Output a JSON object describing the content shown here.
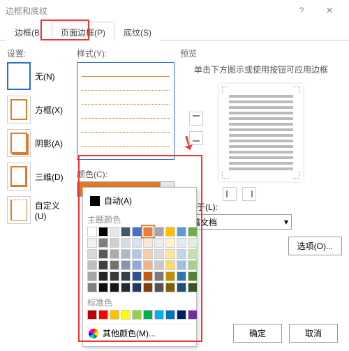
{
  "title": "边框和底纹",
  "tabs": {
    "border": "边框(B)",
    "page_border": "页面边框(P)",
    "shading": "底纹(S)"
  },
  "settings": {
    "label": "设置:",
    "none": "无(N)",
    "box": "方框(X)",
    "shadow": "阴影(A)",
    "threed": "三维(D)",
    "custom": "自定义(U)"
  },
  "style_label": "样式(Y):",
  "color": {
    "label": "颜色(C):",
    "auto": "自动(A)",
    "theme": "主题颜色",
    "standard": "标准色",
    "more": "其他颜色(M)...",
    "theme_row1": [
      "#ffffff",
      "#000000",
      "#e7e6e6",
      "#44546a",
      "#4472c4",
      "#ed7d31",
      "#a5a5a5",
      "#ffc000",
      "#5b9bd5",
      "#70ad47"
    ],
    "theme_row2": [
      "#f2f2f2",
      "#7f7f7f",
      "#d0cece",
      "#d6dce4",
      "#d9e2f3",
      "#fbe5d5",
      "#ededed",
      "#fff2cc",
      "#deebf6",
      "#e2efd9"
    ],
    "theme_row3": [
      "#d8d8d8",
      "#595959",
      "#aeabab",
      "#adb9ca",
      "#b4c6e7",
      "#f7cbac",
      "#dbdbdb",
      "#fee599",
      "#bdd7ee",
      "#c5e0b3"
    ],
    "theme_row4": [
      "#bfbfbf",
      "#3f3f3f",
      "#757070",
      "#8496b0",
      "#8eaadb",
      "#f4b183",
      "#c9c9c9",
      "#ffd965",
      "#9cc3e5",
      "#a8d08d"
    ],
    "theme_row5": [
      "#a5a5a5",
      "#262626",
      "#3a3838",
      "#323f4f",
      "#2f5496",
      "#c55a11",
      "#7b7b7b",
      "#bf9000",
      "#2e75b5",
      "#538135"
    ],
    "theme_row6": [
      "#7f7f7f",
      "#0c0c0c",
      "#171616",
      "#222a35",
      "#1f3864",
      "#833c0b",
      "#525252",
      "#7f6000",
      "#1e4e79",
      "#375623"
    ],
    "standard_row": [
      "#c00000",
      "#ff0000",
      "#ffc000",
      "#ffff00",
      "#92d050",
      "#00b050",
      "#00b0f0",
      "#0070c0",
      "#002060",
      "#7030a0"
    ],
    "selected_hex": "#ed7d31"
  },
  "preview": {
    "label": "预览",
    "hint": "单击下方图示或使用按钮可应用边框"
  },
  "apply": {
    "label": "应用于(L):",
    "value": "整篇文档"
  },
  "options_btn": "选项(O)...",
  "ok": "确定",
  "cancel": "取消"
}
